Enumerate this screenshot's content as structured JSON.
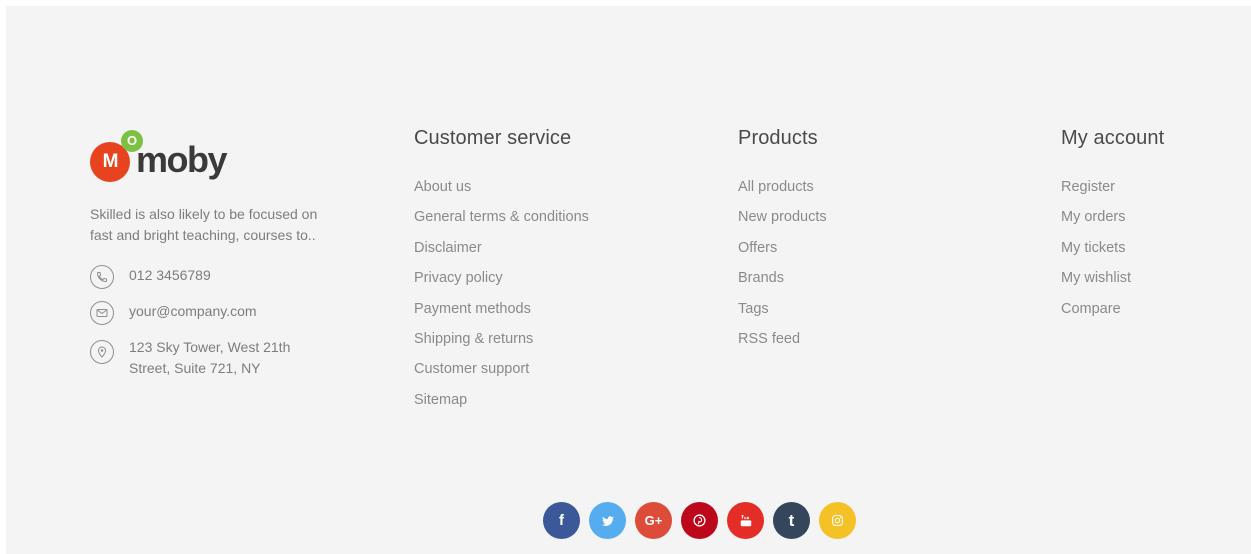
{
  "brand": {
    "logo_badge_letter": "M",
    "logo_dot_letter": "O",
    "logo_wordmark": "moby",
    "description": "Skilled is also likely to be focused on fast and bright teaching, courses to..",
    "phone": "012 3456789",
    "email": "your@company.com",
    "address": "123 Sky Tower, West 21th Street, Suite 721, NY"
  },
  "customer_service": {
    "heading": "Customer service",
    "links": [
      "About us",
      "General terms & conditions",
      "Disclaimer",
      "Privacy policy",
      "Payment methods",
      "Shipping & returns",
      "Customer support",
      "Sitemap"
    ]
  },
  "products": {
    "heading": "Products",
    "links": [
      "All products",
      "New products",
      "Offers",
      "Brands",
      "Tags",
      "RSS feed"
    ]
  },
  "my_account": {
    "heading": "My account",
    "links": [
      "Register",
      "My orders",
      "My tickets",
      "My wishlist",
      "Compare"
    ]
  },
  "social": [
    {
      "icon": "facebook-icon",
      "glyph": "f",
      "color": "#3b5998"
    },
    {
      "icon": "twitter-icon",
      "glyph": "",
      "color": "#55acee"
    },
    {
      "icon": "google-plus-icon",
      "glyph": "G+",
      "color": "#dd4b39"
    },
    {
      "icon": "pinterest-icon",
      "glyph": "",
      "color": "#bd081c"
    },
    {
      "icon": "youtube-icon",
      "glyph": "",
      "color": "#e52d27"
    },
    {
      "icon": "tumblr-icon",
      "glyph": "t",
      "color": "#35465c"
    },
    {
      "icon": "instagram-icon",
      "glyph": "",
      "color": "#f4c127"
    }
  ],
  "colors": {
    "background": "#f4f4f4",
    "logo_red": "#e8431f",
    "logo_green": "#7cc143",
    "link": "#8a8a8a",
    "heading": "#4a4a4a"
  }
}
